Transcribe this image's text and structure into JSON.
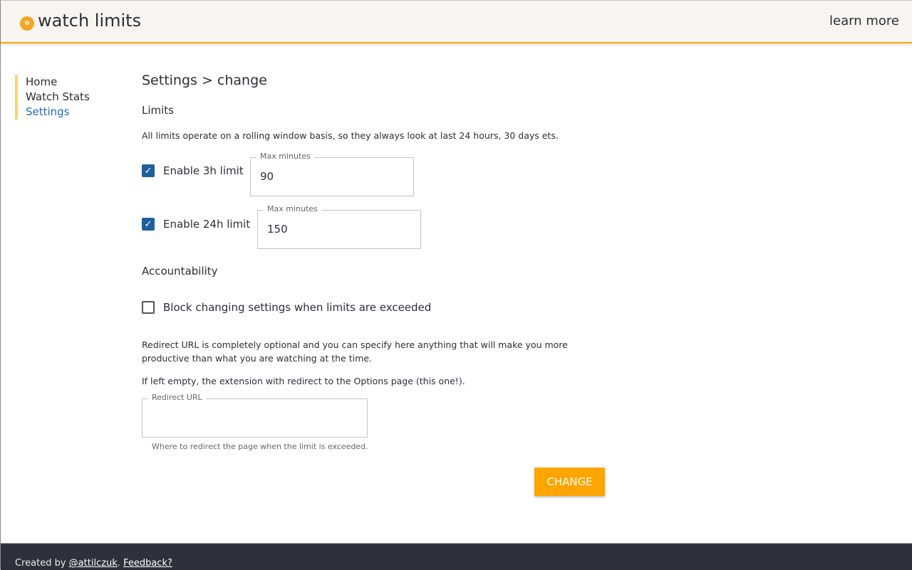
{
  "header": {
    "logo_letter": "o",
    "title": "watch limits",
    "learn_more": "learn more"
  },
  "nav": {
    "items": [
      "Home",
      "Watch Stats",
      "Settings"
    ]
  },
  "main": {
    "heading": "Settings > change",
    "limits_title": "Limits",
    "limits_desc": "All limits operate on a rolling window basis, so they always look at last 24 hours, 30 days ets.",
    "limit3h": {
      "label": "Enable 3h limit",
      "checked": true,
      "field_label": "Max minutes",
      "value": "90"
    },
    "limit24h": {
      "label": "Enable 24h limit",
      "checked": true,
      "field_label": "Max minutes",
      "value": "150"
    },
    "accountability_title": "Accountability",
    "block": {
      "label": "Block changing settings when limits are exceeded",
      "checked": false
    },
    "redirect_desc1": "Redirect URL is completely optional and you can specify here anything that will make you more productive than what you are watching at the time.",
    "redirect_desc2": "If left empty, the extension with redirect to the Options page (this one!).",
    "redirect": {
      "field_label": "Redirect URL",
      "value": "",
      "help": "Where to redirect the page when the limit is exceeded."
    },
    "submit": "CHANGE"
  },
  "footer": {
    "created_by": "Created by ",
    "author": "@attilczuk",
    "sep": ". ",
    "feedback": "Feedback?"
  },
  "colors": {
    "accent": "#ffa500",
    "link": "#236bb5",
    "footer_bg": "#2d313b"
  }
}
